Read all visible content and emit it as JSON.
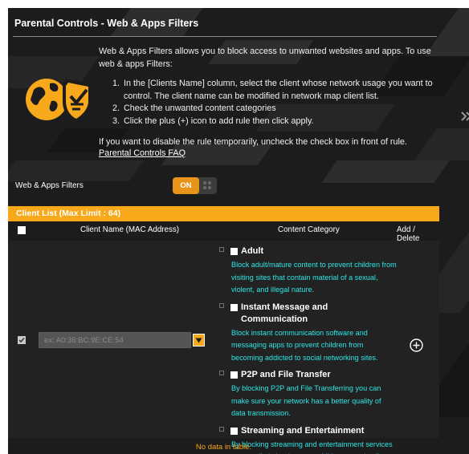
{
  "page": {
    "title": "Parental Controls - Web & Apps Filters"
  },
  "intro": {
    "description": "Web & Apps Filters allows you to block access to unwanted websites and apps. To use web & apps Filters:",
    "steps": [
      {
        "num": "1.",
        "text": "In the [Clients Name] column, select the client whose network usage you want to",
        "cont": "control. The client name can be modified in network map client list."
      },
      {
        "num": "2.",
        "text": "Check the unwanted content categories"
      },
      {
        "num": "3.",
        "text": "Click the plus (+) icon to add rule then click apply."
      }
    ],
    "disable_text": "If you want to disable the rule temporarily, uncheck the check box in front of rule.",
    "faq_link": "Parental Controls FAQ"
  },
  "filter_toggle": {
    "label": "Web & Apps Filters",
    "state": "ON"
  },
  "client_list": {
    "header": "Client List (Max Limit : 64)",
    "columns": {
      "name": "Client Name (MAC Address)",
      "category": "Content Category",
      "actions": "Add / Delete"
    },
    "mac_placeholder": "ex: A0:36:BC:9E:CE:54",
    "categories": [
      {
        "title": "Adult",
        "description": "Block adult/mature content to prevent children from visiting sites that contain material of a sexual, violent, and illegal nature."
      },
      {
        "title": "Instant Message and Communication",
        "description": "Block instant communication software and messaging apps to prevent children from becoming addicted to social networking sites."
      },
      {
        "title": "P2P and File Transfer",
        "description": "By blocking P2P and File Transferring you can make sure your network has a better quality of data transmission."
      },
      {
        "title": "Streaming and Entertainment",
        "description": "By blocking streaming and entertainment services you can limit the time your children spend online."
      }
    ],
    "empty_text": "No data in table."
  },
  "colors": {
    "accent": "#f7a81b",
    "toggle_on": "#e8941a",
    "category_desc": "#2fe6e6",
    "background": "#1c1c1c"
  },
  "icons": {
    "hero": "globe-shield-icon",
    "add": "plus-circle-icon",
    "dropdown": "chevron-down-icon"
  }
}
